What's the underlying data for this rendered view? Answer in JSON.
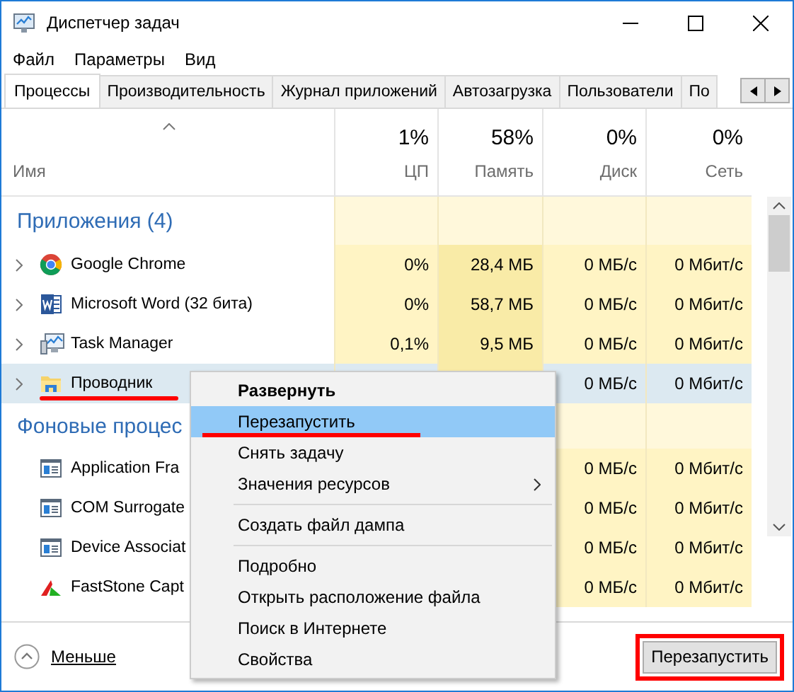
{
  "window": {
    "title": "Диспетчер задач"
  },
  "menu": [
    "Файл",
    "Параметры",
    "Вид"
  ],
  "tabs": [
    {
      "label": "Процессы",
      "selected": true
    },
    {
      "label": "Производительность",
      "selected": false
    },
    {
      "label": "Журнал приложений",
      "selected": false
    },
    {
      "label": "Автозагрузка",
      "selected": false
    },
    {
      "label": "Пользователи",
      "selected": false
    },
    {
      "label": "По",
      "selected": false
    }
  ],
  "table": {
    "columns": [
      {
        "label": "Имя"
      },
      {
        "label": "ЦП",
        "usage": "1%"
      },
      {
        "label": "Память",
        "usage": "58%"
      },
      {
        "label": "Диск",
        "usage": "0%"
      },
      {
        "label": "Сеть",
        "usage": "0%"
      }
    ],
    "rows": [
      {
        "kind": "group",
        "name": "Приложения (4)"
      },
      {
        "kind": "process",
        "expandable": true,
        "selected": false,
        "name": "Google Chrome",
        "cpu": "0%",
        "memory": "28,4 МБ",
        "disk": "0 МБ/с",
        "network": "0 Мбит/с"
      },
      {
        "kind": "process",
        "expandable": true,
        "selected": false,
        "name": "Microsoft Word (32 бита)",
        "cpu": "0%",
        "memory": "58,7 МБ",
        "disk": "0 МБ/с",
        "network": "0 Мбит/с"
      },
      {
        "kind": "process",
        "expandable": true,
        "selected": false,
        "name": "Task Manager",
        "cpu": "0,1%",
        "memory": "9,5 МБ",
        "disk": "0 МБ/с",
        "network": "0 Мбит/с"
      },
      {
        "kind": "process",
        "expandable": true,
        "selected": true,
        "name": "Проводник",
        "disk": "0 МБ/с",
        "network": "0 Мбит/с"
      },
      {
        "kind": "group",
        "name": "Фоновые процес"
      },
      {
        "kind": "process",
        "expandable": false,
        "selected": false,
        "name": "Application Fra",
        "disk": "0 МБ/с",
        "network": "0 Мбит/с"
      },
      {
        "kind": "process",
        "expandable": false,
        "selected": false,
        "name": "COM Surrogate",
        "disk": "0 МБ/с",
        "network": "0 Мбит/с"
      },
      {
        "kind": "process",
        "expandable": false,
        "selected": false,
        "name": "Device Associat",
        "disk": "0 МБ/с",
        "network": "0 Мбит/с"
      },
      {
        "kind": "process",
        "expandable": false,
        "selected": false,
        "name": "FastStone Capt",
        "disk": "0 МБ/с",
        "network": "0 Мбит/с"
      }
    ]
  },
  "context_menu": {
    "items": [
      {
        "kind": "item",
        "label": "Развернуть",
        "default": true,
        "selected": false,
        "submenu": false,
        "marked": false
      },
      {
        "kind": "item",
        "label": "Перезапустить",
        "default": false,
        "selected": true,
        "submenu": false,
        "marked": true
      },
      {
        "kind": "item",
        "label": "Снять задачу",
        "default": false,
        "selected": false,
        "submenu": false,
        "marked": false
      },
      {
        "kind": "item",
        "label": "Значения ресурсов",
        "default": false,
        "selected": false,
        "submenu": true,
        "marked": false
      },
      {
        "kind": "separator"
      },
      {
        "kind": "item",
        "label": "Создать файл дампа",
        "default": false,
        "selected": false,
        "submenu": false,
        "marked": false
      },
      {
        "kind": "separator"
      },
      {
        "kind": "item",
        "label": "Подробно",
        "default": false,
        "selected": false,
        "submenu": false,
        "marked": false
      },
      {
        "kind": "item",
        "label": "Открыть расположение файла",
        "default": false,
        "selected": false,
        "submenu": false,
        "marked": false
      },
      {
        "kind": "item",
        "label": "Поиск в Интернете",
        "default": false,
        "selected": false,
        "submenu": false,
        "marked": false
      },
      {
        "kind": "item",
        "label": "Свойства",
        "default": false,
        "selected": false,
        "submenu": false,
        "marked": false
      }
    ]
  },
  "footer": {
    "toggle": "Меньше",
    "button": {
      "label": "Перезапустить",
      "marked": true
    }
  }
}
